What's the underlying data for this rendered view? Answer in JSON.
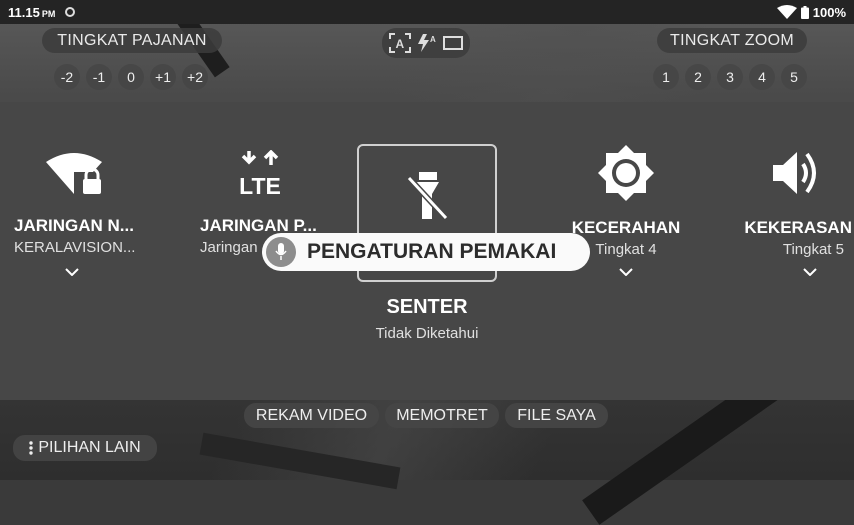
{
  "status": {
    "time": "11.15",
    "ampm": "PM",
    "battery": "100%"
  },
  "exposure": {
    "title": "TINGKAT PAJANAN",
    "levels": [
      "-2",
      "-1",
      "0",
      "+1",
      "+2"
    ]
  },
  "zoom": {
    "title": "TINGKAT ZOOM",
    "levels": [
      "1",
      "2",
      "3",
      "4",
      "5"
    ]
  },
  "quick_settings": [
    {
      "label": "JARINGAN N...",
      "sub": "KERALAVISION...",
      "icon": "wifi-lock-icon"
    },
    {
      "label": "JARINGAN P...",
      "sub": "Jaringan",
      "icon": "lte-icon"
    },
    {
      "label": "SENTER",
      "sub": "Tidak Diketahui",
      "icon": "flashlight-off-icon"
    },
    {
      "label": "KECERAHAN",
      "sub": "Tingkat 4",
      "icon": "brightness-icon"
    },
    {
      "label": "KEKERASAN",
      "sub": "Tingkat 5",
      "icon": "volume-icon"
    }
  ],
  "voice_overlay": {
    "text": "PENGATURAN PEMAKAI",
    "icon": "mic-icon"
  },
  "bottom": {
    "record_video": "REKAM VIDEO",
    "take_photo": "MEMOTRET",
    "my_files": "FILE SAYA",
    "more_options": "PILIHAN LAIN"
  }
}
